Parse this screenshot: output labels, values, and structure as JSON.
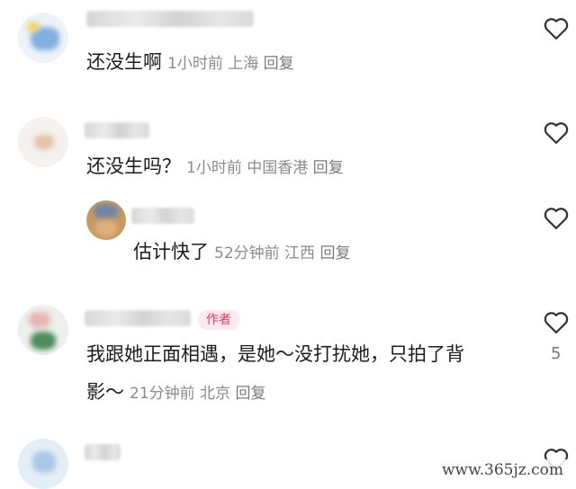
{
  "comments": [
    {
      "text": "还没生啊",
      "time": "1小时前",
      "location": "上海",
      "reply": "回复"
    },
    {
      "text": "还没生吗？",
      "time": "1小时前",
      "location": "中国香港",
      "reply": "回复"
    },
    {
      "text": "估计快了",
      "time": "52分钟前",
      "location": "江西",
      "reply": "回复"
    },
    {
      "text_line1": "我跟她正面相遇，是她～没打扰她，只拍了背",
      "text_line2": "影～",
      "time": "21分钟前",
      "location": "北京",
      "reply": "回复",
      "author_tag": "作者",
      "likes": "5"
    },
    {
      "text": ""
    }
  ],
  "watermark": "www.365jz.com",
  "icons": {
    "like": "heart-outline-icon"
  },
  "colors": {
    "author_tag": "#e8385e",
    "meta_text": "#8a8a8a"
  }
}
